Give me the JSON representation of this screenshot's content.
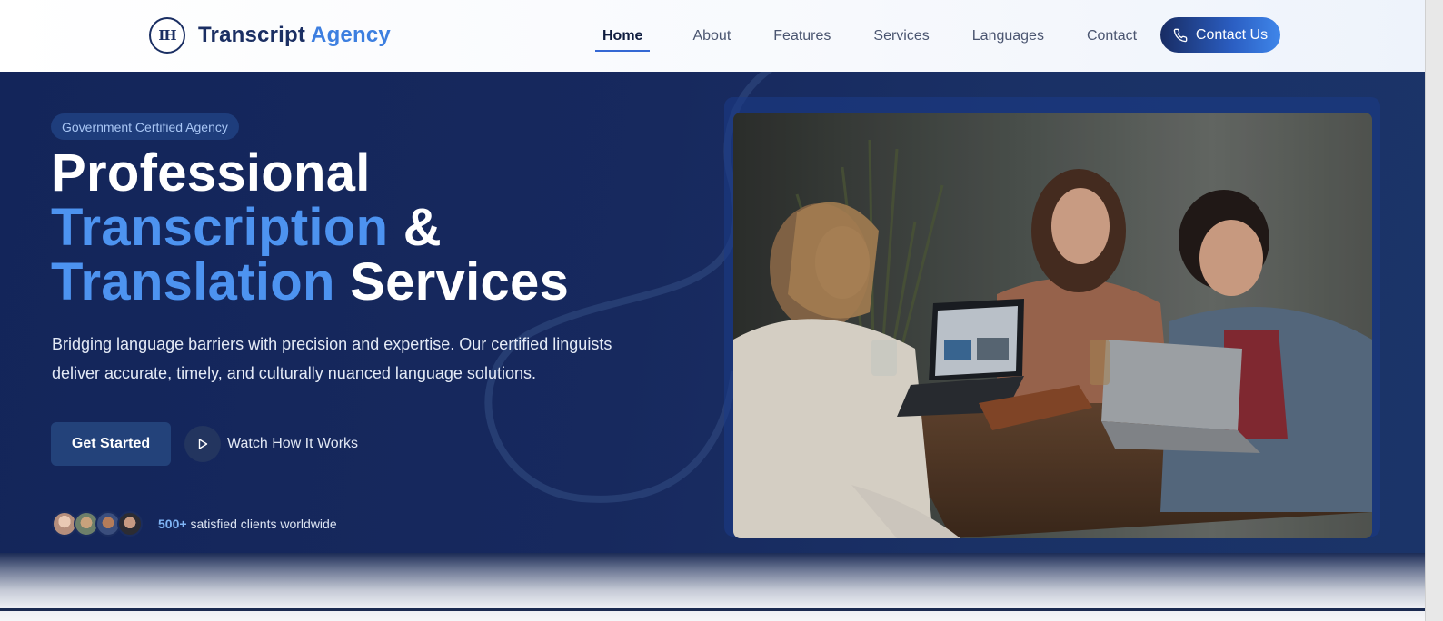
{
  "nav": {
    "logo_monogram": "IH",
    "brand_main": "Transcript",
    "brand_accent": "Agency",
    "links": [
      {
        "label": "Home",
        "active": true
      },
      {
        "label": "About",
        "active": false
      },
      {
        "label": "Features",
        "active": false
      },
      {
        "label": "Services",
        "active": false
      },
      {
        "label": "Languages",
        "active": false
      },
      {
        "label": "Contact",
        "active": false
      }
    ],
    "cta_label": "Contact Us",
    "cta_icon": "phone-icon"
  },
  "hero": {
    "badge": "Government Certified Agency",
    "headline": {
      "line1": "Professional",
      "line2_accent": "Transcription",
      "line2_rest": " &",
      "line3_accent": "Translation",
      "line3_rest": " Services"
    },
    "lead_line1": "Bridging language barriers with precision and expertise. Our certified linguists",
    "lead_line2": "deliver accurate, timely, and culturally nuanced language solutions.",
    "primary_button": "Get Started",
    "secondary_button": "Watch How It Works",
    "secondary_icon": "play-icon",
    "clients_count": "500+",
    "clients_text": "satisfied clients worldwide",
    "photo_icon": "team-meeting-photo"
  },
  "colors": {
    "navy": "#13255a",
    "accent_blue": "#4d93f0",
    "brand_navy": "#1b2f63"
  }
}
